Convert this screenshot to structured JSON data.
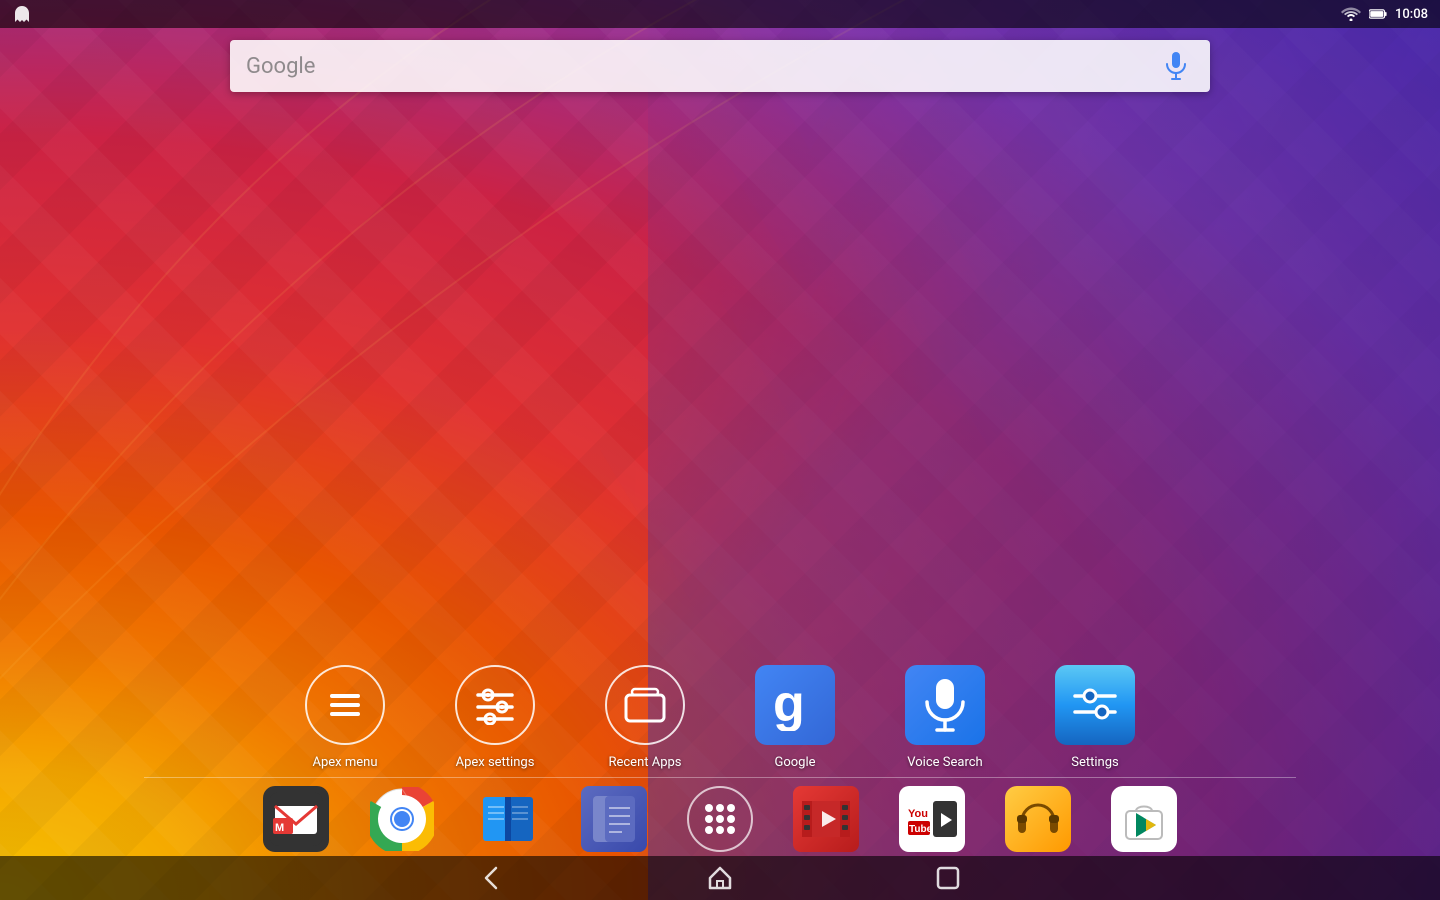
{
  "statusBar": {
    "time": "10:08"
  },
  "searchBar": {
    "placeholder": "Google",
    "micLabel": "Voice search"
  },
  "appGrid": {
    "apps": [
      {
        "id": "apex-menu",
        "label": "Apex menu",
        "type": "circle",
        "iconType": "menu-lines"
      },
      {
        "id": "apex-settings",
        "label": "Apex settings",
        "type": "circle",
        "iconType": "sliders"
      },
      {
        "id": "recent-apps",
        "label": "Recent Apps",
        "type": "circle",
        "iconType": "recent-rect"
      },
      {
        "id": "google",
        "label": "Google",
        "type": "square-blue",
        "iconType": "google-g"
      },
      {
        "id": "voice-search",
        "label": "Voice Search",
        "type": "square-voice",
        "iconType": "mic"
      },
      {
        "id": "settings",
        "label": "Settings",
        "type": "square-settings",
        "iconType": "settings-sliders"
      }
    ]
  },
  "dock": {
    "apps": [
      {
        "id": "gmail",
        "label": "Gmail",
        "iconType": "gmail"
      },
      {
        "id": "chrome",
        "label": "Chrome",
        "iconType": "chrome"
      },
      {
        "id": "book",
        "label": "Book",
        "iconType": "book"
      },
      {
        "id": "notes",
        "label": "Notes",
        "iconType": "notes"
      },
      {
        "id": "drawer",
        "label": "App drawer",
        "iconType": "drawer"
      },
      {
        "id": "film",
        "label": "Film",
        "iconType": "film"
      },
      {
        "id": "youtube",
        "label": "YouTube",
        "iconType": "youtube"
      },
      {
        "id": "headphones",
        "label": "Headphones",
        "iconType": "headphones"
      },
      {
        "id": "playstore",
        "label": "Play Store",
        "iconType": "playstore"
      }
    ]
  },
  "navBar": {
    "back": "Back",
    "home": "Home",
    "recents": "Recents"
  }
}
